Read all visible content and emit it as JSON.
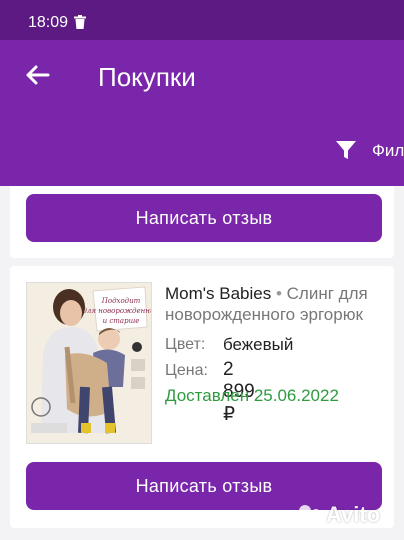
{
  "status_bar": {
    "time": "18:09",
    "icon": "trash-icon"
  },
  "app_bar": {
    "title": "Покупки",
    "back_icon": "arrow-left-icon",
    "filter_icon": "funnel-icon",
    "filter_label": "Фил"
  },
  "cards": [
    {
      "review_button": "Написать отзыв"
    },
    {
      "product": {
        "brand": "Mom's Babies",
        "separator": "•",
        "name_line1": "Слинг для",
        "name_line2": "новорожденного эргорюк",
        "color_label": "Цвет:",
        "color_value": "бежевый",
        "price_label": "Цена:",
        "price_value": "2 899 ₽",
        "delivered": "Доставлен 25.06.2022",
        "image_caption": "Подходит для новорожденных и старше"
      },
      "review_button": "Написать отзыв"
    }
  ],
  "watermark": "Avito",
  "colors": {
    "status_bar": "#5c1a82",
    "app_bar": "#7a26aa",
    "button": "#7a26aa",
    "delivered": "#2e9b3f"
  }
}
